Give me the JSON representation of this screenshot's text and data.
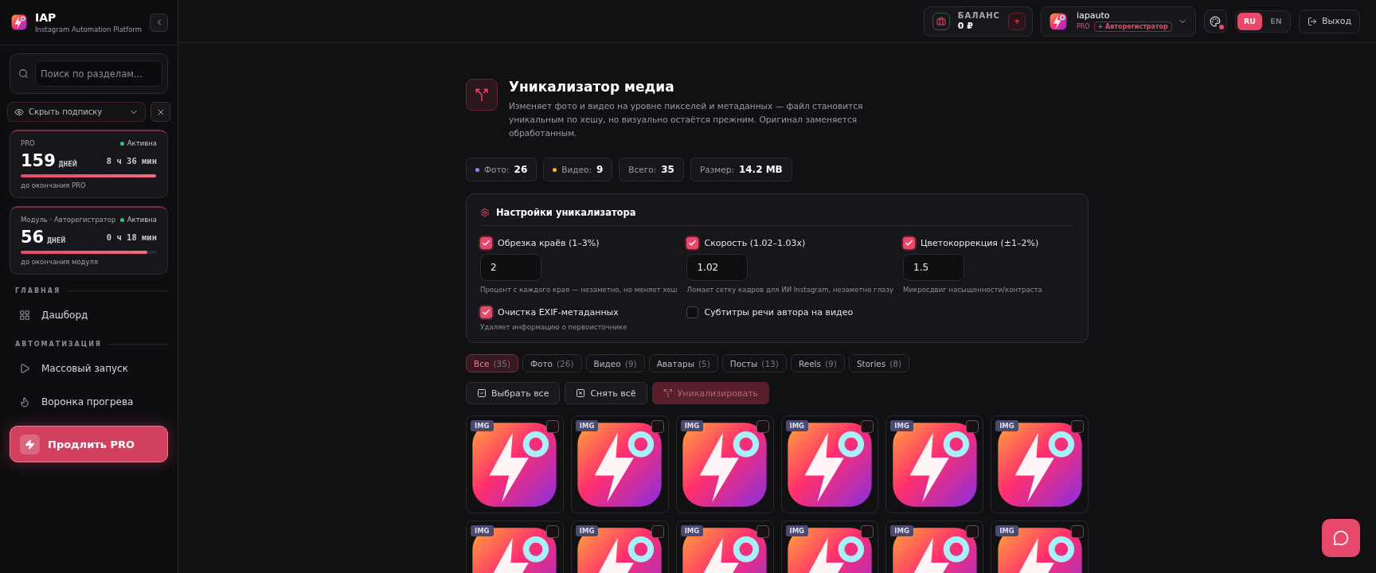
{
  "brand": {
    "name": "IAP",
    "tagline": "Instagram Automation Platform"
  },
  "sidebar": {
    "search": {
      "placeholder": "Поиск по разделам..."
    },
    "subscription_toggle": {
      "label": "Скрыть подписку"
    },
    "plans": [
      {
        "name": "PRO",
        "status": "Активна",
        "days": "159",
        "days_unit": "ДНЕЙ",
        "time": "8 ч 36 мин",
        "level": 0.995,
        "caption": "до окончания PRO"
      },
      {
        "name": "Модуль · Авторегистратор",
        "status": "Активна",
        "days": "56",
        "days_unit": "ДНЕЙ",
        "time": "0 ч 18 мин",
        "level": 0.93,
        "caption": "до окончания модуля"
      }
    ],
    "sections": [
      {
        "title": "ГЛАВНАЯ",
        "items": [
          {
            "label": "Дашборд"
          }
        ]
      },
      {
        "title": "АВТОМАТИЗАЦИЯ",
        "items": [
          {
            "label": "Массовый запуск"
          },
          {
            "label": "Воронка прогрева"
          }
        ]
      }
    ],
    "extend_button": {
      "label": "Продлить",
      "suffix": "PRO"
    }
  },
  "header": {
    "balance": {
      "label": "БАЛАНС",
      "amount": "0 ₽",
      "add": "+"
    },
    "user": {
      "name": "iapauto",
      "plan": "PRO",
      "tag": "+ Авторегистратор"
    },
    "languages": [
      {
        "label": "RU",
        "selected": true
      },
      {
        "label": "EN",
        "selected": false
      }
    ],
    "logout": "Выход"
  },
  "page": {
    "title": "Уникализатор медиа",
    "description": "Изменяет фото и видео на уровне пикселей и метаданных — файл становится уникальным по хешу, но визуально остаётся прежним. Оригинал заменяется обработанным.",
    "stats": [
      {
        "label": "Фото:",
        "value": "26",
        "color": "#8b8cf5"
      },
      {
        "label": "Видео:",
        "value": "9",
        "color": "#f5b82e"
      },
      {
        "label": "Всего:",
        "value": "35"
      },
      {
        "label": "Размер:",
        "value": "14.2 MB"
      }
    ]
  },
  "settings": {
    "title": "Настройки уникализатора",
    "options": [
      {
        "kind": "input",
        "label": "Обрезка краёв (1–3%)",
        "checked": true,
        "value": "2",
        "hint": "Процент с каждого края — незаметно, но меняет хеш"
      },
      {
        "kind": "input",
        "label": "Скорость (1.02–1.03x)",
        "checked": true,
        "value": "1.02",
        "hint": "Ломает сетку кадров для ИИ Instagram, незаметно глазу"
      },
      {
        "kind": "input",
        "label": "Цветокоррекция (±1–2%)",
        "checked": true,
        "value": "1.5",
        "hint": "Микросдвиг насыщенности/контраста"
      },
      {
        "kind": "plain",
        "label": "Очистка EXIF-метаданных",
        "checked": true,
        "hint": "Удаляет информацию о первоисточнике"
      },
      {
        "kind": "plain",
        "label": "Субтитры речи автора на видео",
        "checked": false
      }
    ]
  },
  "filters": [
    {
      "label": "Все",
      "count": "(35)",
      "selected": true
    },
    {
      "label": "Фото",
      "count": "(26)",
      "selected": false
    },
    {
      "label": "Видео",
      "count": "(9)",
      "selected": false
    },
    {
      "label": "Аватары",
      "count": "(5)",
      "selected": false
    },
    {
      "label": "Посты",
      "count": "(13)",
      "selected": false
    },
    {
      "label": "Reels",
      "count": "(9)",
      "selected": false
    },
    {
      "label": "Stories",
      "count": "(8)",
      "selected": false
    }
  ],
  "actions": [
    {
      "kind": "select",
      "label": "Выбрать все",
      "disabled": false
    },
    {
      "kind": "clear",
      "label": "Снять всё",
      "disabled": false
    },
    {
      "kind": "run",
      "label": "Уникализировать",
      "disabled": true
    }
  ],
  "media": [
    {
      "badge": "IMG",
      "selected": false
    },
    {
      "badge": "IMG",
      "selected": false
    },
    {
      "badge": "IMG",
      "selected": false
    },
    {
      "badge": "IMG",
      "selected": false
    },
    {
      "badge": "IMG",
      "selected": false
    },
    {
      "badge": "IMG",
      "selected": false
    },
    {
      "badge": "IMG",
      "selected": false
    },
    {
      "badge": "IMG",
      "selected": false
    },
    {
      "badge": "IMG",
      "selected": false
    },
    {
      "badge": "IMG",
      "selected": false
    },
    {
      "badge": "IMG",
      "selected": false
    },
    {
      "badge": "IMG",
      "selected": false
    }
  ]
}
